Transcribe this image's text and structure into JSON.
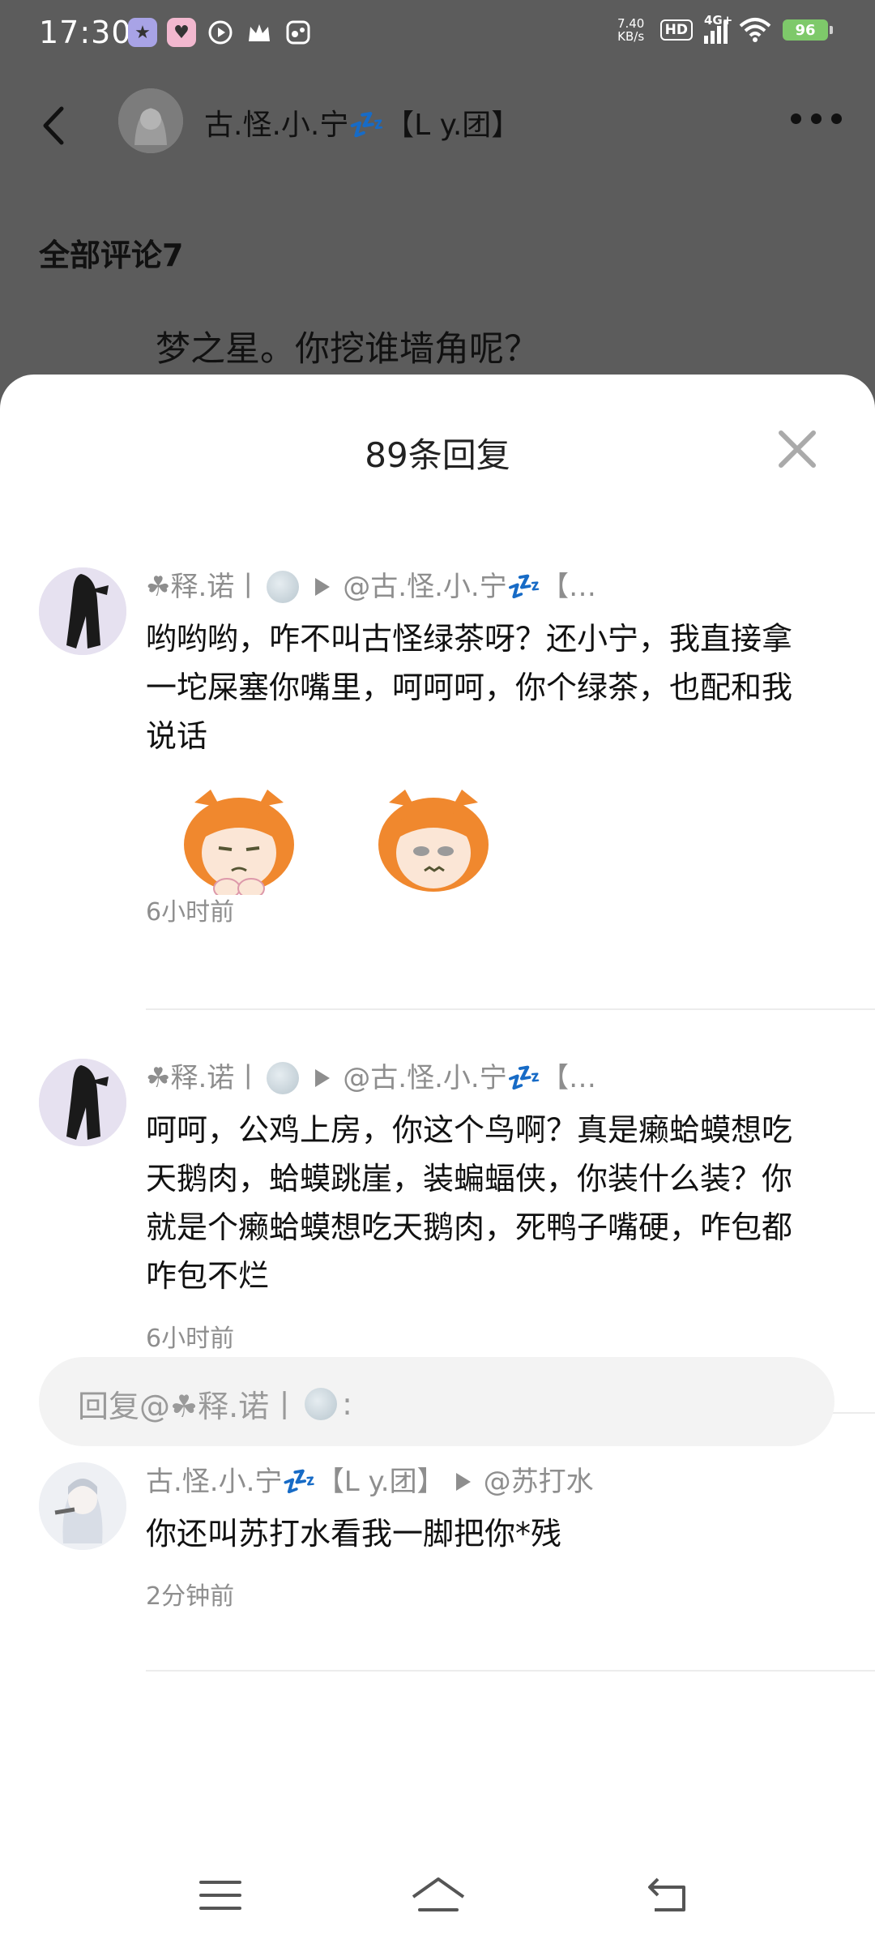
{
  "status_bar": {
    "time": "17:30",
    "net_speed_value": "7.40",
    "net_speed_unit": "KB/s",
    "hd": "HD",
    "signal": "4G+",
    "battery": "96",
    "app_icons": [
      "game-app-icon",
      "anime-app-icon",
      "video-play-icon",
      "crown-icon",
      "gamepad-icon"
    ]
  },
  "nav": {
    "title": "古.怪.小.宁💤【L y.团】",
    "back_icon": "chevron-left-icon",
    "more_icon": "more-dots-icon"
  },
  "background": {
    "comments_header": "全部评论7",
    "comment_preview": "梦之星。你挖谁墙角呢？"
  },
  "sheet": {
    "title": "89条回复",
    "close_icon": "close-icon",
    "replies": [
      {
        "author": "☘释.诺丨",
        "reply_to": "@古.怪.小.宁💤【…",
        "text": "哟哟哟，咋不叫古怪绿茶呀？还小宁，我直接拿一坨屎塞你嘴里，呵呵呵，你个绿茶，也配和我说话",
        "time": "6小时前",
        "has_stickers": true
      },
      {
        "author": "☘释.诺丨",
        "reply_to": "@古.怪.小.宁💤【…",
        "text": "呵呵，公鸡上房，你这个鸟啊？真是癞蛤蟆想吃天鹅肉，蛤蟆跳崖，装蝙蝠侠，你装什么装？你就是个癞蛤蟆想吃天鹅肉，死鸭子嘴硬，咋包都咋包不烂",
        "time": "6小时前",
        "has_stickers": false
      },
      {
        "author": "古.怪.小.宁💤【L y.团】",
        "reply_to": "@苏打水",
        "text": "你还叫苏打水看我一脚把你*残",
        "time": "2分钟前",
        "has_stickers": false
      }
    ]
  },
  "input": {
    "placeholder_prefix": "回复@☘释.诺丨",
    "placeholder_suffix": ":"
  },
  "system_nav": {
    "icons": [
      "menu-icon",
      "home-icon",
      "back-icon"
    ]
  },
  "colors": {
    "overlay": "#5e5e5e",
    "sheet_bg": "#ffffff",
    "meta_text": "#8e8e8e",
    "input_bg": "#f3f3f3",
    "sticker_orange": "#f0882e"
  }
}
